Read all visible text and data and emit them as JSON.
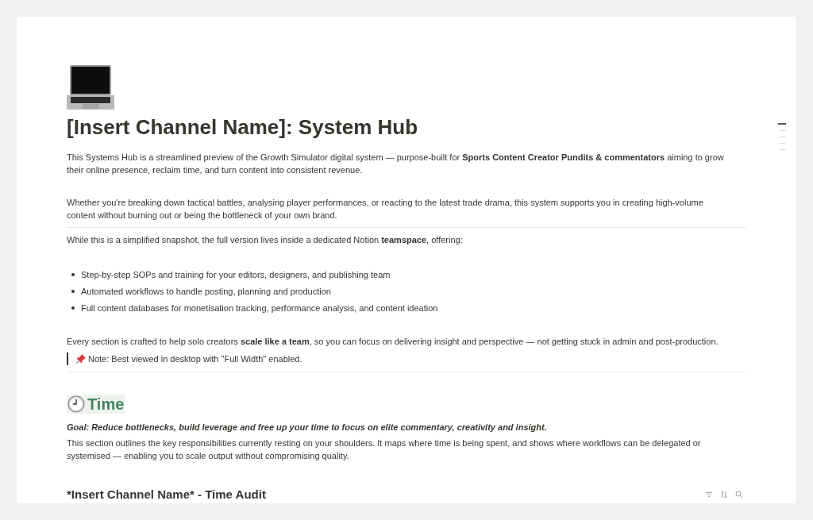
{
  "page": {
    "title": "[Insert Channel Name]: System Hub"
  },
  "intro": [
    "This Systems Hub is a streamlined preview of the Growth Simulator digital system — purpose-built for **Sports Content Creator Pundits & commentators** aiming to grow their online presence, reclaim time, and turn content into consistent revenue.",
    "Whether you're breaking down tactical battles, analysing player performances, or reacting to the latest trade drama, this system supports you in creating high-volume content without burning out or being the bottleneck of your own brand."
  ],
  "offering": "While this is a simplified snapshot, the full version lives inside a dedicated Notion **teamspace**, offering:",
  "bullets": [
    "Step-by-step SOPs and training for your editors, designers, and publishing team",
    "Automated workflows to handle posting, planning and production",
    "Full content databases for monetisation tracking, performance analysis, and content ideation"
  ],
  "closing": "Every section is crafted to help solo creators **scale like a team**, so you can focus on delivering insight and perspective — not getting stuck in admin and post-production.",
  "note": "Note: Best viewed in desktop with \"Full Width\" enabled.",
  "section": {
    "heading": "Time",
    "goal": "Goal: Reduce bottlenecks, build leverage and free up your time to focus on elite commentary, creativity and insight.",
    "description": "This section outlines the key responsibilities currently resting on your shoulders. It maps where time is being spent, and shows where workflows can be delegated or systemised — enabling you to scale output without compromising quality."
  },
  "database": {
    "title": "*Insert Channel Name* - Time Audit"
  },
  "outline": [
    {
      "selected": true
    },
    {
      "selected": false
    },
    {
      "selected": false
    },
    {
      "selected": false
    },
    {
      "selected": false
    }
  ]
}
